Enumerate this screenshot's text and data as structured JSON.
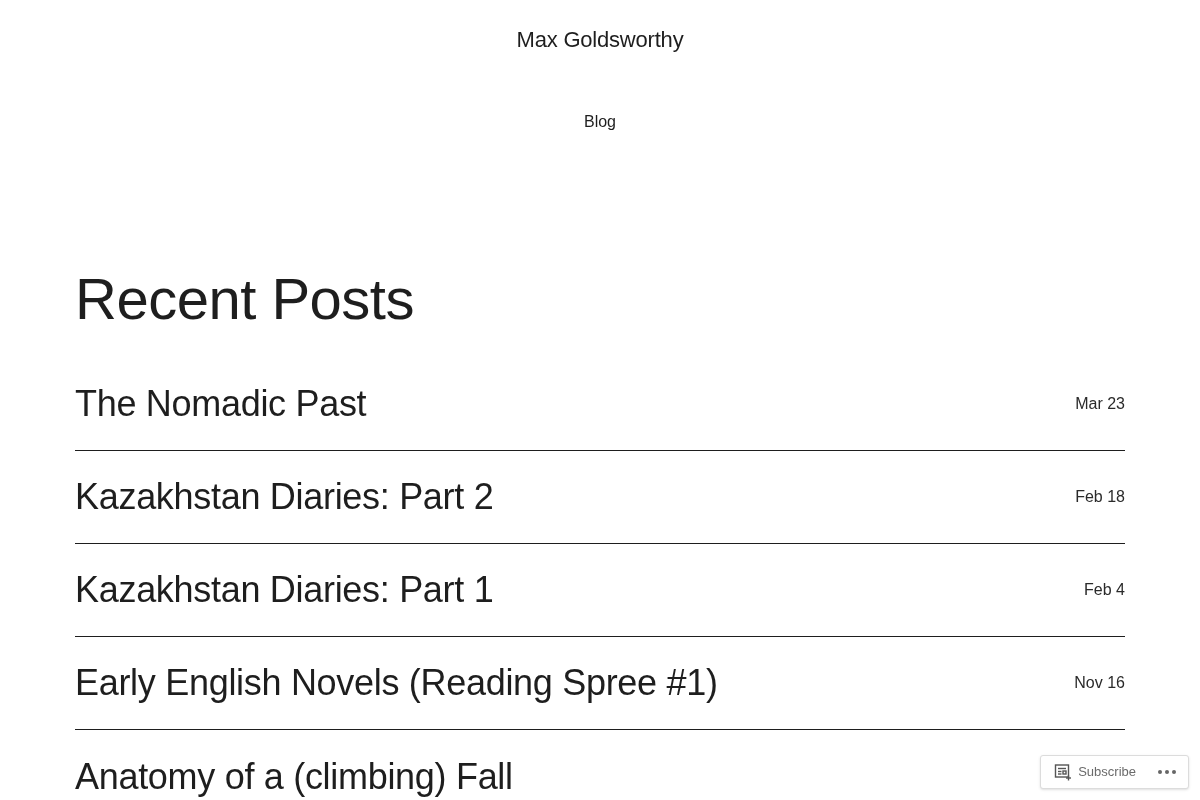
{
  "header": {
    "site_title": "Max Goldsworthy",
    "nav": [
      {
        "label": "Blog"
      }
    ]
  },
  "main": {
    "heading": "Recent Posts",
    "posts": [
      {
        "title": "The Nomadic Past",
        "date": "Mar 23"
      },
      {
        "title": "Kazakhstan Diaries: Part 2",
        "date": "Feb 18"
      },
      {
        "title": "Kazakhstan Diaries: Part 1",
        "date": "Feb 4"
      },
      {
        "title": "Early English Novels (Reading Spree #1)",
        "date": "Nov 16"
      },
      {
        "title": "Anatomy of a (climbing) Fall"
      }
    ]
  },
  "subscribe_bar": {
    "button": "Subscribe"
  }
}
